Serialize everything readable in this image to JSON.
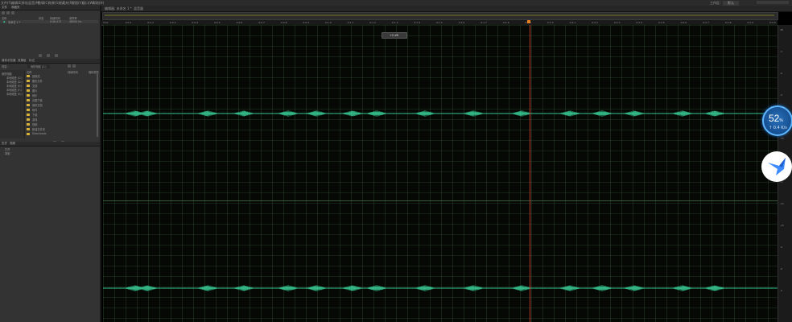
{
  "menubar": {
    "items": [
      "文件(F)",
      "编辑(E)",
      "多轨混音(M)",
      "剪辑(C)",
      "效果(S)",
      "收藏夹(R)",
      "视图(V)",
      "窗口(W)",
      "帮助(H)"
    ],
    "workspace_label": "工作区：",
    "workspace_value": "默认"
  },
  "files_panel": {
    "title": "文件",
    "tab2": "收藏夹",
    "columns": [
      "名称",
      "状态",
      "持续时间",
      "采样率"
    ],
    "file_name": "未命名 1 *",
    "file_duration": "0:06.417",
    "file_rate": "48000 Hz"
  },
  "media_panel": {
    "title": "媒体浏览器",
    "tab2": "效果组",
    "tab3": "标记",
    "show_label": "内容：",
    "drive_value": "我的电脑 (C:)",
    "tree_items": [
      "我的电脑",
      "本地磁盘 (C:)",
      "本地磁盘 (D:)",
      "本地磁盘 (E:)",
      "本地磁盘 (F:)",
      "本地磁盘 (G:)"
    ],
    "list_header_name": "名称",
    "list_header_duration": "持续时间",
    "list_header_type": "媒体类型",
    "list_items": [
      "回收站",
      "备份文件",
      "文档",
      "图片",
      "音乐",
      "迅雷下载",
      "我的文档",
      "软件",
      "下载",
      "游戏",
      "视频",
      "新建文件夹",
      "Downloads"
    ]
  },
  "history_panel": {
    "title": "历史",
    "tab2": "视频",
    "items": [
      "打开",
      "录制"
    ]
  },
  "editor": {
    "tab_label": "编辑器: 未命名 1 *",
    "tab2": "混音器",
    "gain_value": "+0 dB",
    "ruler_labels": [
      "hms",
      "0:0.1",
      "0:0.2",
      "0:0.3",
      "0:0.4",
      "0:0.5",
      "0:0.6",
      "0:0.7",
      "0:0.8",
      "0:0.9",
      "0:1.0",
      "0:1.1",
      "0:1.2",
      "0:1.3",
      "0:1.4",
      "0:1.5",
      "0:1.6",
      "0:1.7",
      "0:1.8",
      "0:1.9",
      "0:2.0",
      "0:2.1",
      "0:2.2",
      "0:2.3",
      "0:2.4",
      "0:2.5",
      "0:2.6",
      "0:2.7",
      "0:2.8",
      "0:2.9",
      "0:3.0"
    ],
    "scale_labels": [
      "dB",
      "-3",
      "-6",
      "-9",
      "-12",
      "-15",
      "-21",
      "-∞",
      "-21",
      "-15",
      "-9",
      "-6",
      "-3"
    ]
  },
  "net_widget": {
    "percent": "52",
    "percent_unit": "%",
    "speed": "↑ 0.4 K/s"
  },
  "colors": {
    "waveform": "#3ad39a",
    "playhead": "#c0392b",
    "accent": "#2a6fb8"
  }
}
